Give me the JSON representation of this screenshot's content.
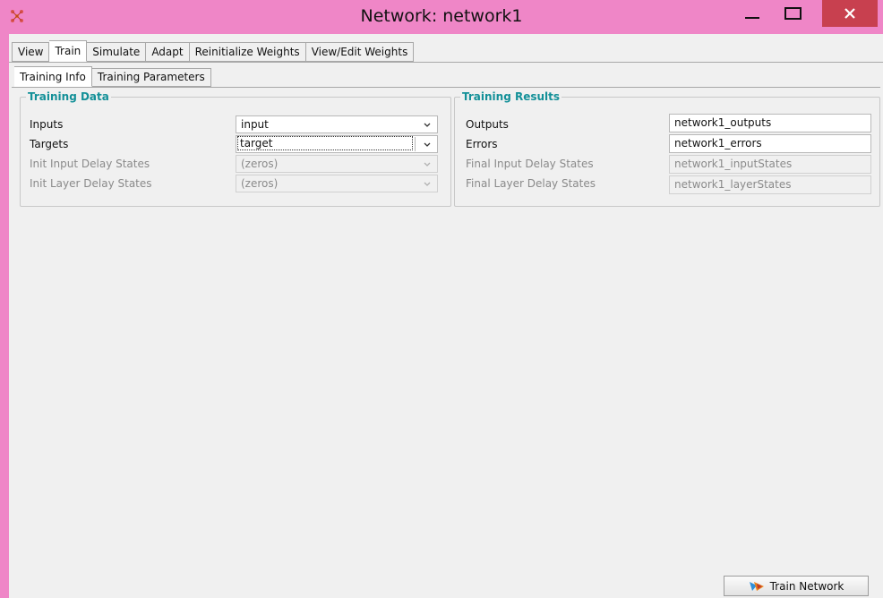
{
  "window": {
    "title": "Network: network1"
  },
  "tabs": [
    {
      "label": "View"
    },
    {
      "label": "Train",
      "active": true
    },
    {
      "label": "Simulate"
    },
    {
      "label": "Adapt"
    },
    {
      "label": "Reinitialize Weights"
    },
    {
      "label": "View/Edit Weights"
    }
  ],
  "subtabs": [
    {
      "label": "Training Info",
      "active": true
    },
    {
      "label": "Training Parameters"
    }
  ],
  "training_data": {
    "title": "Training Data",
    "inputs_label": "Inputs",
    "inputs_value": "input",
    "targets_label": "Targets",
    "targets_value": "target",
    "init_input_label": "Init Input Delay States",
    "init_input_value": "(zeros)",
    "init_layer_label": "Init Layer Delay States",
    "init_layer_value": "(zeros)"
  },
  "training_results": {
    "title": "Training Results",
    "outputs_label": "Outputs",
    "outputs_value": "network1_outputs",
    "errors_label": "Errors",
    "errors_value": "network1_errors",
    "final_input_label": "Final Input Delay States",
    "final_input_value": "network1_inputStates",
    "final_layer_label": "Final Layer Delay States",
    "final_layer_value": "network1_layerStates"
  },
  "actions": {
    "train_label": "Train Network"
  },
  "colors": {
    "titlebar": "#ef86c7",
    "group_title": "#139098",
    "close_button": "#c8404f"
  }
}
